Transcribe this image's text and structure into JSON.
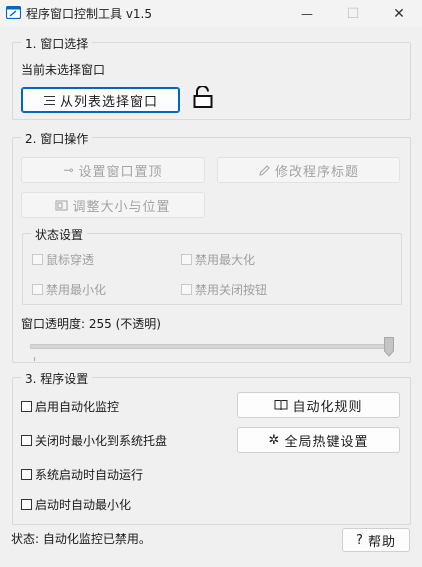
{
  "window": {
    "title": "程序窗口控制工具 v1.5",
    "minimize_glyph": "—",
    "maximize_glyph": "☐",
    "close_glyph": "✕"
  },
  "window_select": {
    "title": "1. 窗口选择",
    "current": "当前未选择窗口",
    "select_button": "从列表选择窗口",
    "select_icon": "list-icon",
    "lock_icon": "unlocked-padlock-icon"
  },
  "window_ops": {
    "title": "2. 窗口操作",
    "pin_button": "设置窗口置顶",
    "rename_button": "修改程序标题",
    "resize_button": "调整大小与位置",
    "state": {
      "title": "状态设置",
      "mouse_through": "鼠标穿透",
      "disable_maximize": "禁用最大化",
      "disable_minimize": "禁用最小化",
      "disable_close": "禁用关闭按钮"
    },
    "opacity_label": "窗口透明度: 255 (不透明)",
    "opacity_value": 255,
    "opacity_max": 255
  },
  "program_settings": {
    "title": "3. 程序设置",
    "enable_monitor": "启用自动化监控",
    "minimize_to_tray": "关闭时最小化到系统托盘",
    "autostart": "系统启动时自动运行",
    "start_minimized": "启动时自动最小化",
    "rules_button": "自动化规则",
    "hotkeys_button": "全局热键设置"
  },
  "status": {
    "text": "状态: 自动化监控已禁用。"
  },
  "help_button": "帮助",
  "colors": {
    "accent": "#0067c0",
    "background": "#f0f0f0"
  }
}
